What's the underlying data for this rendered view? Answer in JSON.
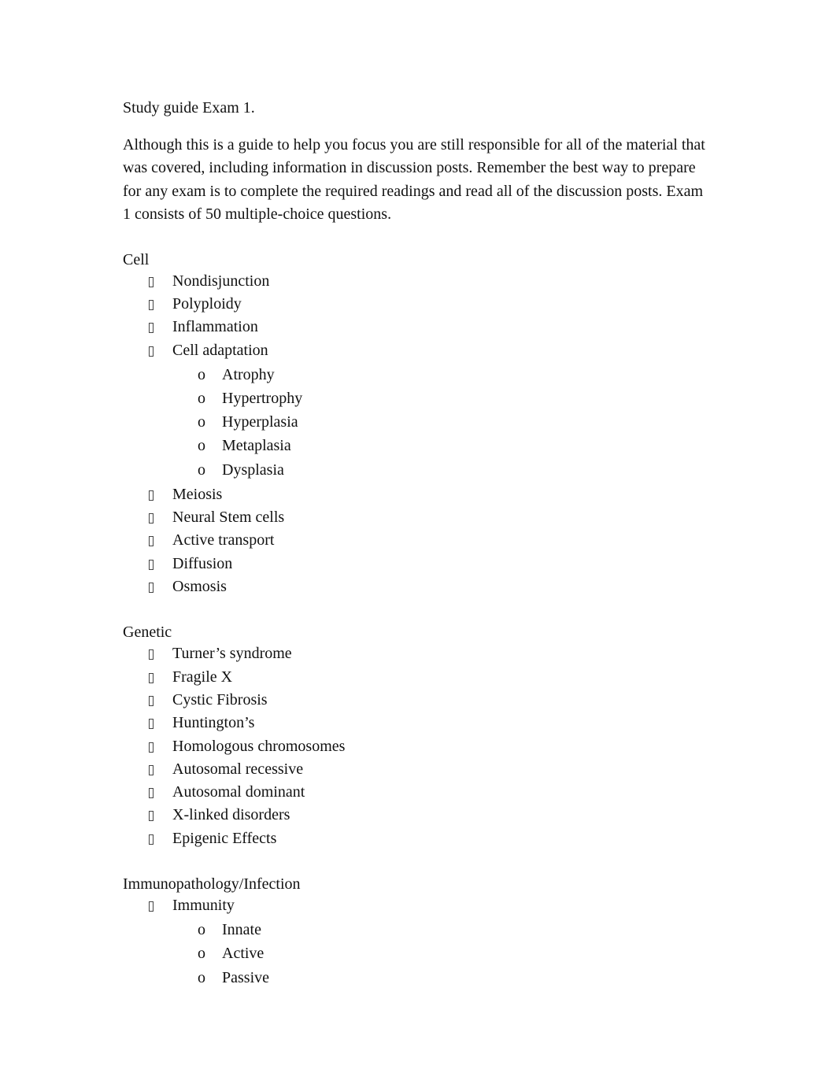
{
  "document": {
    "title": "Study guide Exam 1.",
    "intro": "Although this is a guide to help you focus you are still responsible for all of the material that was covered, including information in discussion posts.   Remember the best way to prepare for any exam is to complete the required readings and read all of the discussion posts.  Exam 1 consists of 50 multiple-choice questions.",
    "bullet_icon": "missing-glyph-box",
    "sub_bullet_glyph": "o",
    "sections": [
      {
        "heading": "Cell",
        "items": [
          {
            "label": "Nondisjunction"
          },
          {
            "label": "Polyploidy"
          },
          {
            "label": "Inflammation"
          },
          {
            "label": "Cell adaptation",
            "subitems": [
              "Atrophy",
              "Hypertrophy",
              "Hyperplasia",
              "Metaplasia",
              "Dysplasia"
            ]
          },
          {
            "label": "Meiosis"
          },
          {
            "label": "Neural Stem cells"
          },
          {
            "label": "Active transport"
          },
          {
            "label": "Diffusion"
          },
          {
            "label": "Osmosis"
          }
        ]
      },
      {
        "heading": "Genetic",
        "items": [
          {
            "label": "Turner’s syndrome"
          },
          {
            "label": "Fragile X"
          },
          {
            "label": "Cystic Fibrosis"
          },
          {
            "label": "Huntington’s"
          },
          {
            "label": "Homologous chromosomes"
          },
          {
            "label": "Autosomal recessive"
          },
          {
            "label": "Autosomal dominant"
          },
          {
            "label": "X-linked disorders"
          },
          {
            "label": "Epigenic Effects"
          }
        ]
      },
      {
        "heading": "Immunopathology/Infection",
        "items": [
          {
            "label": "Immunity",
            "subitems": [
              "Innate",
              "Active",
              "Passive"
            ]
          }
        ]
      }
    ]
  }
}
